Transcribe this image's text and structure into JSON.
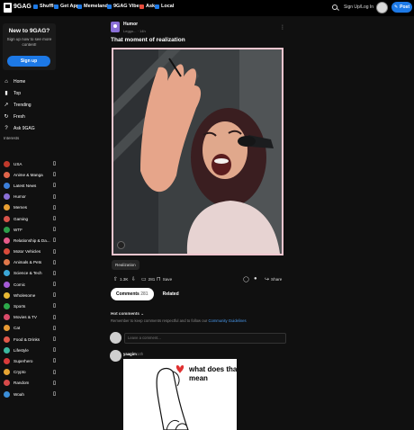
{
  "topbar": {
    "brand": "9GAG",
    "nav": [
      {
        "label": "Shuffle",
        "icon": "shuffle-icon",
        "color": "#1d79e6"
      },
      {
        "label": "Get App",
        "icon": "phone-icon",
        "color": "#1d79e6"
      },
      {
        "label": "Memeland",
        "icon": "memeland-icon",
        "color": "#1d79e6"
      },
      {
        "label": "9GAG Vibes",
        "icon": "vibes-icon",
        "color": "#1d79e6"
      },
      {
        "label": "Ask",
        "icon": "ask-icon",
        "color": "#e64c3c"
      },
      {
        "label": "Local",
        "icon": "local-icon",
        "color": "#1d79e6"
      }
    ],
    "signin": "Sign Up/Log In",
    "post_label": "Post"
  },
  "sidebar": {
    "new_title": "New to 9GAG?",
    "new_subtitle": "Sign up now to see more content!",
    "signup_label": "Sign up",
    "nav": [
      {
        "label": "Home",
        "icon": "home-icon"
      },
      {
        "label": "Top",
        "icon": "top-icon"
      },
      {
        "label": "Trending",
        "icon": "trending-icon"
      },
      {
        "label": "Fresh",
        "icon": "fresh-icon"
      },
      {
        "label": "Ask 9GAG",
        "icon": "ask-icon"
      }
    ],
    "interests_heading": "Interests",
    "interests": [
      {
        "label": "USA",
        "color": "#c0392b"
      },
      {
        "label": "Anime & Manga",
        "color": "#e0654a"
      },
      {
        "label": "Latest News",
        "color": "#3b7ed8"
      },
      {
        "label": "Humor",
        "color": "#8a6fd6"
      },
      {
        "label": "Memes",
        "color": "#e8a033"
      },
      {
        "label": "Gaming",
        "color": "#d8534a"
      },
      {
        "label": "WTF",
        "color": "#2c9e4a"
      },
      {
        "label": "Relationship & Da...",
        "color": "#e65b8a"
      },
      {
        "label": "Motor Vehicles",
        "color": "#d94a3a"
      },
      {
        "label": "Animals & Pets",
        "color": "#e0774a"
      },
      {
        "label": "Science & Tech",
        "color": "#3ba7d8"
      },
      {
        "label": "Comic",
        "color": "#a55bd6"
      },
      {
        "label": "Wholesome",
        "color": "#e8b833"
      },
      {
        "label": "Sports",
        "color": "#2ca84a"
      },
      {
        "label": "Movies & TV",
        "color": "#d84a6a"
      },
      {
        "label": "Cat",
        "color": "#e89a33"
      },
      {
        "label": "Food & Drinks",
        "color": "#e0584a"
      },
      {
        "label": "Lifestyle",
        "color": "#3bb8a0"
      },
      {
        "label": "Superhero",
        "color": "#d93a3a"
      },
      {
        "label": "Crypto",
        "color": "#e8a533"
      },
      {
        "label": "Random",
        "color": "#d84a4a"
      },
      {
        "label": "Woah",
        "color": "#3b8ed8"
      }
    ]
  },
  "post": {
    "section": "Humor",
    "meta": "Leggo... · 14h",
    "title": "That moment of realization",
    "tag": "Realization",
    "upvotes": "1.3K",
    "comments_count": "281",
    "save_label": "Save",
    "share_label": "Share"
  },
  "comments": {
    "tab_comments": "Comments",
    "tab_comments_count": "281",
    "tab_related": "Related",
    "sort_label": "Hot comments",
    "remember_text": "Remember to keep comments respectful and to follow our",
    "guidelines_link": "Community Guidelines",
    "placeholder": "Leave a comment...",
    "first": {
      "user": "yaagim",
      "time": "14h",
      "image_caption": "what does that mean"
    }
  }
}
